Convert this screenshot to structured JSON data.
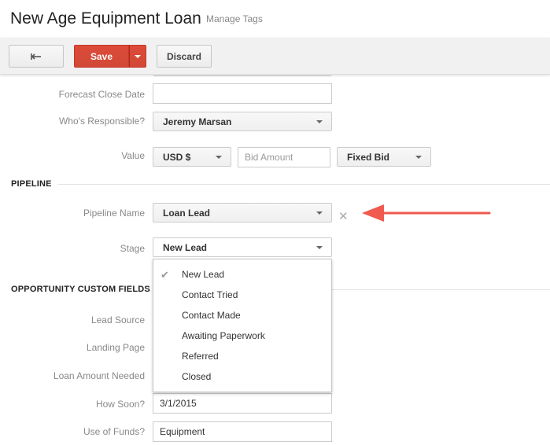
{
  "header": {
    "title": "New Age Equipment Loan",
    "manage_tags": "Manage Tags"
  },
  "toolbar": {
    "back_icon": "back-arrow-icon",
    "save_label": "Save",
    "discard_label": "Discard",
    "accent": "#dd4b39"
  },
  "fields": {
    "forecast_close_date": {
      "label": "Forecast Close Date",
      "value": ""
    },
    "whos_responsible": {
      "label": "Who's Responsible?",
      "value": "Jeremy Marsan"
    },
    "value": {
      "label": "Value",
      "currency": "USD $",
      "bid_placeholder": "Bid Amount",
      "bid_type": "Fixed Bid"
    }
  },
  "pipeline": {
    "section_title": "PIPELINE",
    "name_label": "Pipeline Name",
    "name_value": "Loan Lead",
    "remove_icon": "close-icon",
    "stage_label": "Stage",
    "stage_value": "New Lead",
    "stage_options": [
      "New Lead",
      "Contact Tried",
      "Contact Made",
      "Awaiting Paperwork",
      "Referred",
      "Closed"
    ],
    "selected_option": "New Lead"
  },
  "custom_fields": {
    "section_title": "OPPORTUNITY CUSTOM FIELDS",
    "lead_source_label": "Lead Source",
    "landing_page_label": "Landing Page",
    "loan_amount_label": "Loan Amount Needed",
    "how_soon_label": "How Soon?",
    "how_soon_value": "3/1/2015",
    "use_of_funds_label": "Use of Funds?",
    "use_of_funds_value": "Equipment"
  },
  "annotation": {
    "arrow_color": "#f05a4f"
  }
}
